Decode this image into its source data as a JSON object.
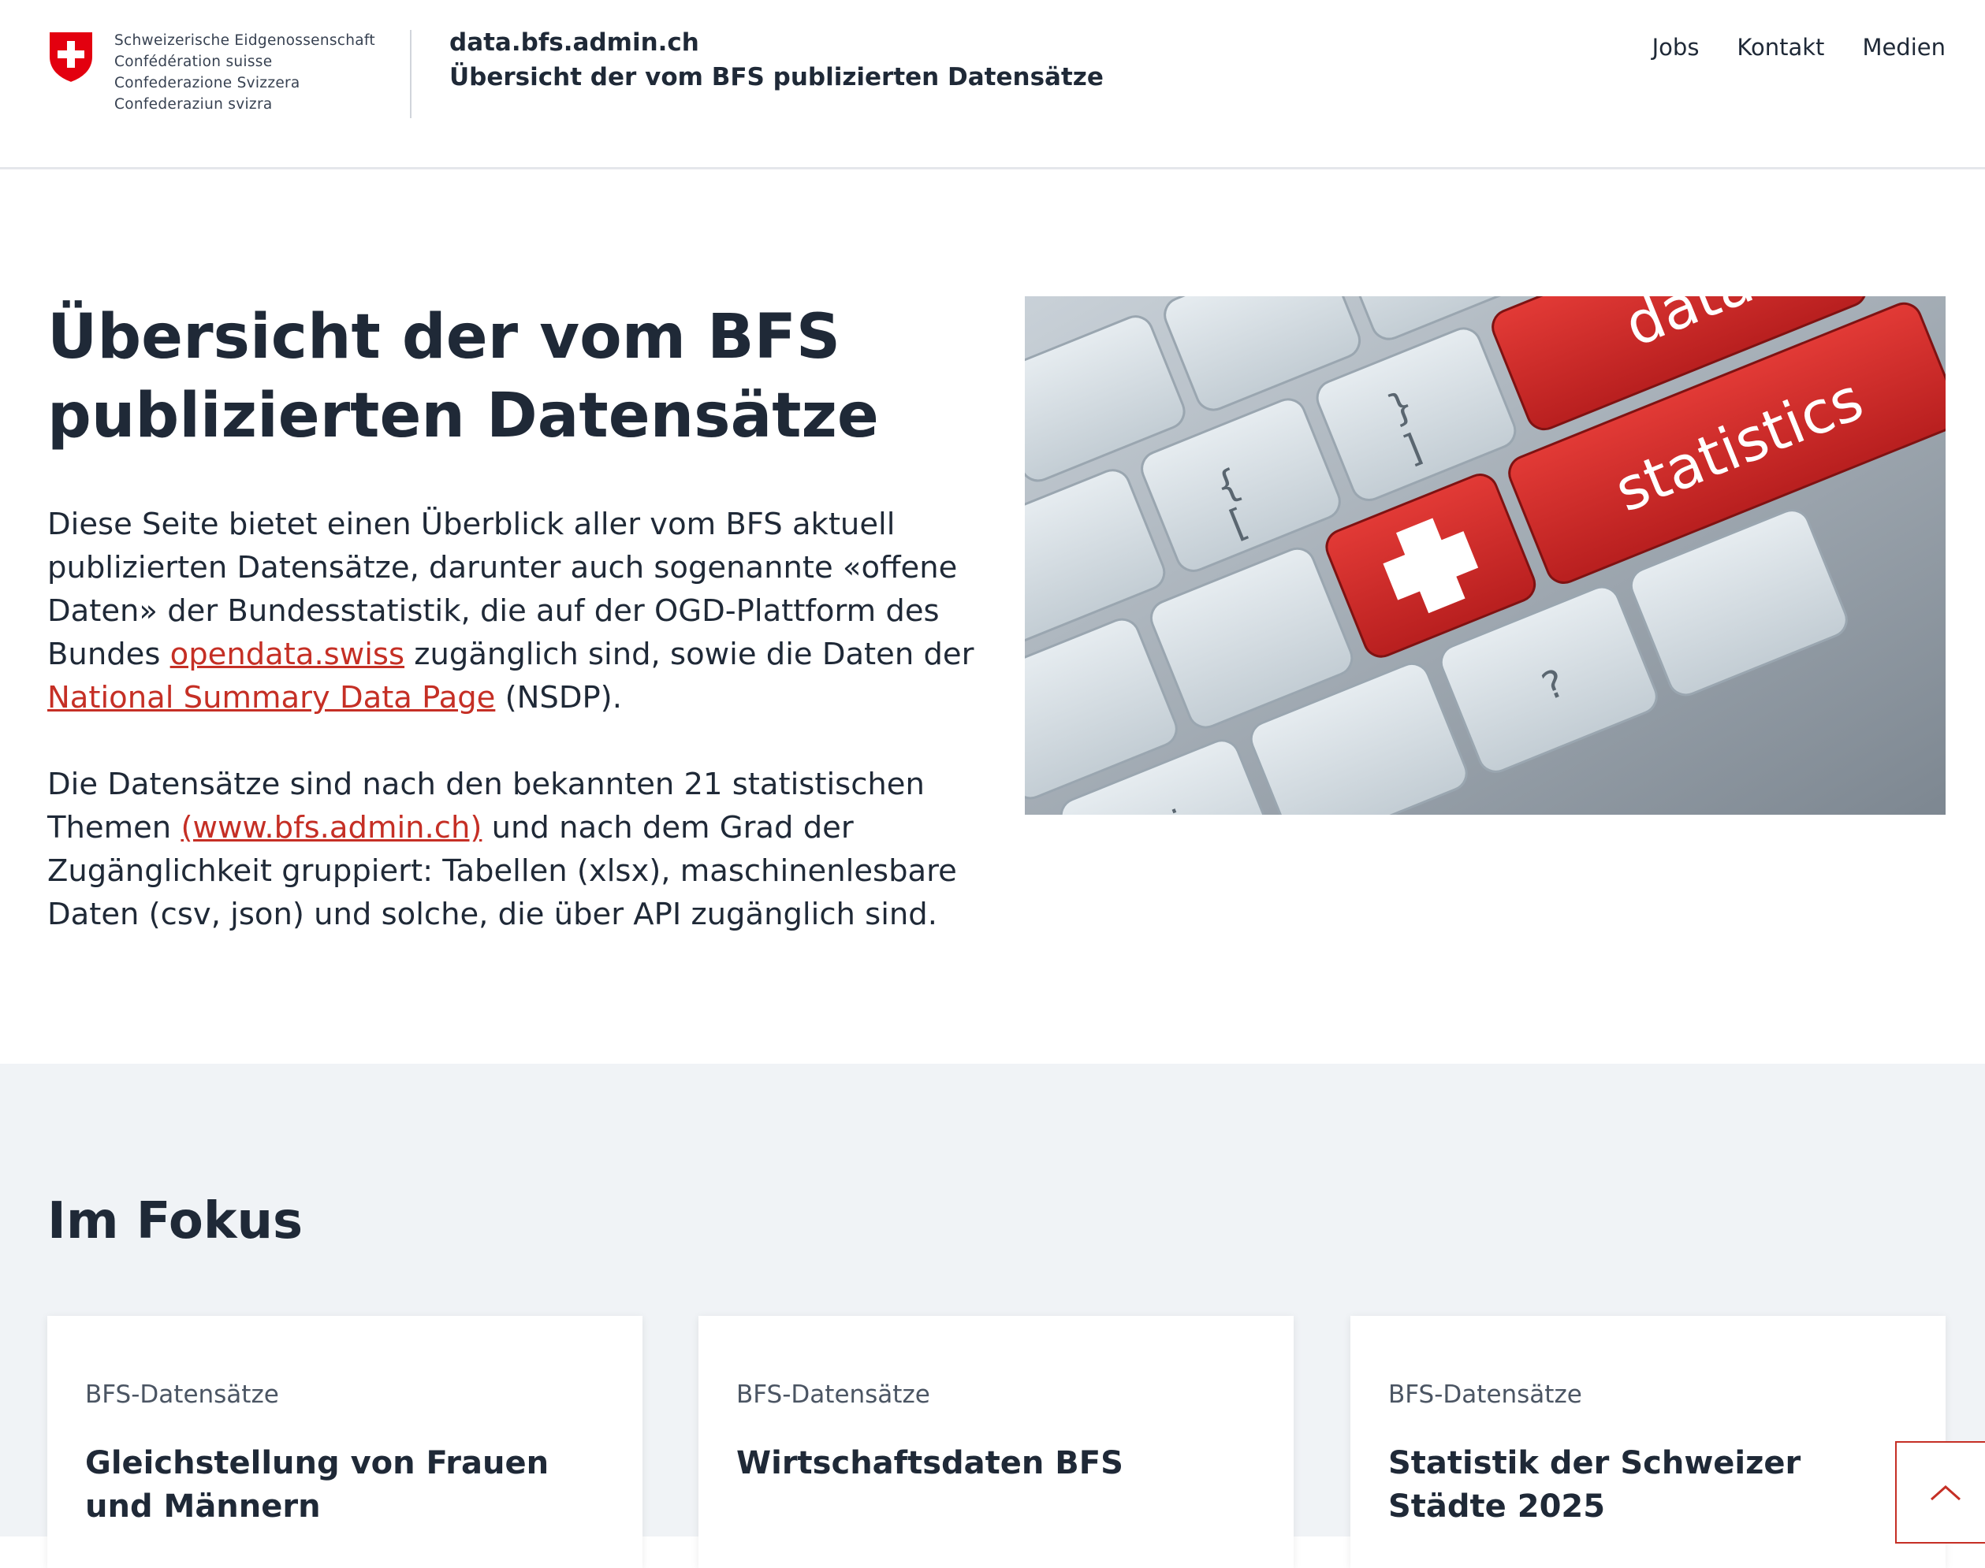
{
  "header": {
    "confederation": [
      "Schweizerische Eidgenossenschaft",
      "Confédération suisse",
      "Confederazione Svizzera",
      "Confederaziun svizra"
    ],
    "site_domain": "data.bfs.admin.ch",
    "site_subtitle": "Übersicht der vom BFS publizierten Datensätze",
    "nav": [
      "Jobs",
      "Kontakt",
      "Medien"
    ]
  },
  "hero": {
    "title": "Übersicht der vom BFS publizierten Datensätze",
    "para1_a": "Diese Seite bietet einen Überblick aller vom BFS aktuell publizierten Datensätze, darunter auch sogenannte «offene Daten» der Bundesstatistik, die auf der OGD-Plattform des Bundes ",
    "link_opendata": "opendata.swiss",
    "para1_b": " zugänglich sind, sowie die Daten der ",
    "link_nsdp": "National Summary Data Page",
    "para1_c": " (NSDP).",
    "para2_a": "Die Datensätze sind nach den bekannten 21 statistischen Themen ",
    "link_bfs": "(www.bfs.admin.ch)",
    "para2_b": " und nach dem Grad der Zugänglichkeit gruppiert: Tabellen (xlsx), maschinenlesbare Daten (csv, json) und solche, die über API zugänglich sind.",
    "image_keys": {
      "key1": "data",
      "key2": "statistics"
    }
  },
  "focus": {
    "title": "Im Fokus",
    "cards": [
      {
        "kicker": "BFS-Datensätze",
        "title": "Gleichstellung von Frauen und Männern"
      },
      {
        "kicker": "BFS-Datensätze",
        "title": "Wirtschaftsdaten BFS"
      },
      {
        "kicker": "BFS-Datensätze",
        "title": "Statistik der Schweizer Städte 2025"
      }
    ]
  },
  "colors": {
    "accent_red": "#c52f25",
    "text_dark": "#1f2937",
    "focus_bg": "#f0f3f6"
  },
  "icons": {
    "logo": "swiss-coat-of-arms-icon",
    "back_to_top": "chevron-up-icon"
  }
}
